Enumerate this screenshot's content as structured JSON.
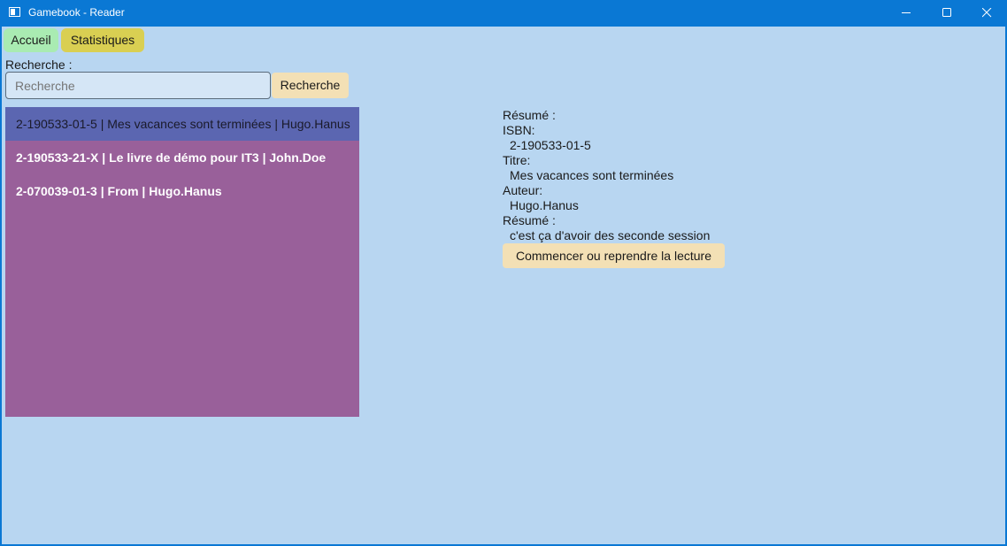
{
  "window": {
    "title": "Gamebook - Reader"
  },
  "nav": {
    "accueil": "Accueil",
    "statistiques": "Statistiques"
  },
  "search": {
    "label": "Recherche :",
    "placeholder": "Recherche",
    "button": "Recherche"
  },
  "books": [
    "2-190533-01-5 | Mes vacances sont terminées | Hugo.Hanus",
    "2-190533-21-X | Le livre de démo pour IT3 | John.Doe",
    "2-070039-01-3 | From | Hugo.Hanus"
  ],
  "details": {
    "header": "Résumé :",
    "isbn_label": "ISBN:",
    "isbn": "2-190533-01-5",
    "title_label": "Titre:",
    "title": "Mes vacances sont terminées",
    "author_label": "Auteur:",
    "author": "Hugo.Hanus",
    "summary_label": "Résumé :",
    "summary": "c'est ça d'avoir des seconde session",
    "read_button": "Commencer ou reprendre la lecture"
  },
  "colors": {
    "titlebar": "#0a78d4",
    "background": "#b8d6f1",
    "list_background": "#99609a",
    "list_selected": "#5b66b1",
    "accueil_button": "#a9ebb2",
    "statistiques_button": "#d9cf52",
    "action_button": "#f3e0b5"
  }
}
